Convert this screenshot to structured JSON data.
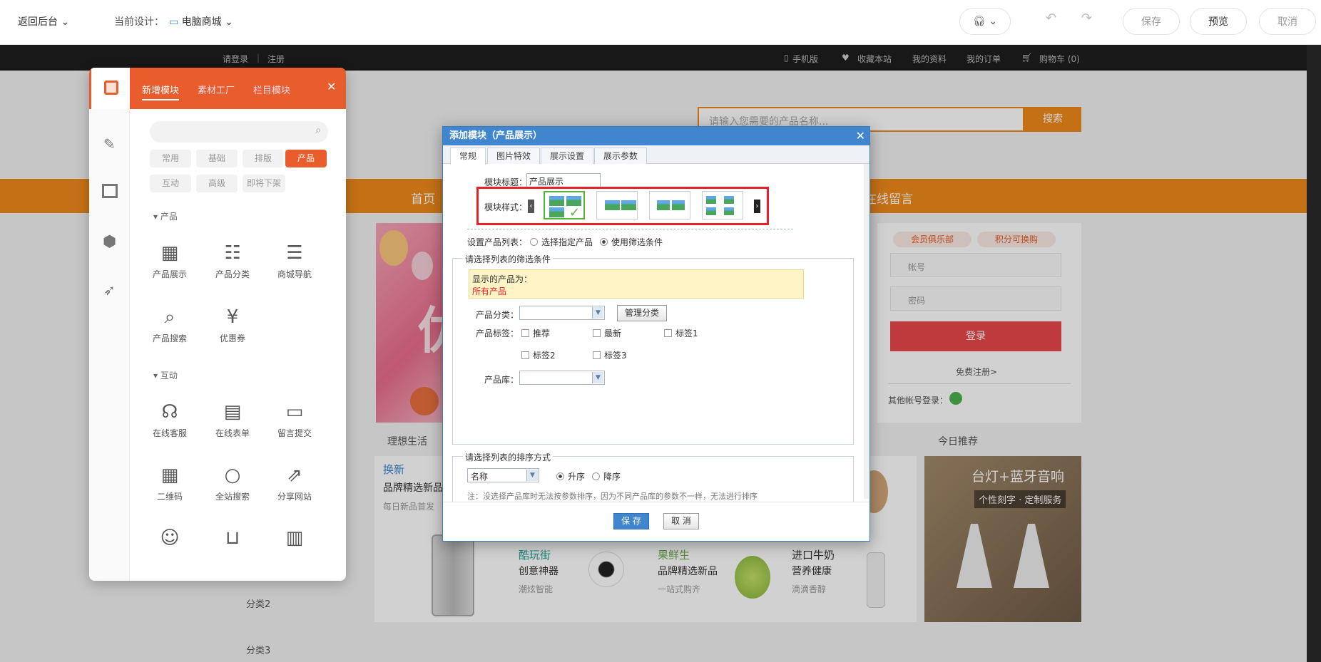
{
  "editor_bar": {
    "back": "返回后台",
    "current_label": "当前设计：",
    "design": "电脑商城",
    "save": "保存",
    "preview": "预览",
    "cancel": "取消"
  },
  "site_top": {
    "login": "请登录",
    "register": "注册",
    "mobile": "手机版",
    "favorite": "收藏本站",
    "profile": "我的资料",
    "orders": "我的订单",
    "cart": "购物车 (0)"
  },
  "search": {
    "placeholder": "请输入您需要的产品名称...",
    "button": "搜索"
  },
  "nav": {
    "home": "首页",
    "message": "在线留言"
  },
  "login_panel": {
    "club": "会员俱乐部",
    "points": "积分可换购",
    "account": "帐号",
    "password": "密码",
    "login": "登录",
    "register": "免费注册>",
    "other": "其他帐号登录："
  },
  "content": {
    "life": "理想生活",
    "today": "今日推荐",
    "swap": "换新",
    "swap_title": "品牌精选新品",
    "swap_sub": "每日新品首发",
    "cool": "酷玩街",
    "cool_title": "创意神器",
    "cool_sub": "潮炫智能",
    "fresh": "果鲜生",
    "fresh_title": "品牌精选新品",
    "fresh_sub": "一站式购齐",
    "milk": "进口牛奶",
    "milk_title": "营养健康",
    "milk_sub": "滴滴香醇",
    "promo_title": "台灯+蓝牙音响",
    "promo_sub": "个性刻字 · 定制服务",
    "cat2": "分类2",
    "cat3": "分类3",
    "banner_char": "优"
  },
  "left_panel": {
    "tabs": [
      "新增模块",
      "素材工厂",
      "栏目模块"
    ],
    "chips": [
      "常用",
      "基础",
      "排版",
      "产品",
      "互动",
      "高级",
      "即将下架"
    ],
    "section_product": "产品",
    "section_interact": "互动",
    "product_mods": [
      "产品展示",
      "产品分类",
      "商城导航",
      "产品搜索",
      "优惠券"
    ],
    "interact_mods": [
      "在线客服",
      "在线表单",
      "留言提交",
      "二维码",
      "全站搜索",
      "分享网站"
    ]
  },
  "dialog": {
    "title": "添加模块（产品展示）",
    "tabs": [
      "常规",
      "图片特效",
      "展示设置",
      "展示参数"
    ],
    "module_title_label": "模块标题：",
    "module_title_value": "产品展示",
    "style_label": "模块样式：",
    "set_list_label": "设置产品列表：",
    "opt_specified": "选择指定产品",
    "opt_filter": "使用筛选条件",
    "filter_legend": "请选择列表的筛选条件",
    "show_label": "显示的产品为：",
    "show_value": "所有产品",
    "category_label": "产品分类：",
    "manage_category": "管理分类",
    "tag_label": "产品标签：",
    "tags": [
      "推荐",
      "最新",
      "标签1",
      "标签2",
      "标签3"
    ],
    "library_label": "产品库：",
    "sort_legend": "请选择列表的排序方式",
    "sort_field": "名称",
    "asc": "升序",
    "desc": "降序",
    "note": "注：没选择产品库时无法按参数排序，因为不同产品库的参数不一样，无法进行排序",
    "save": "保 存",
    "cancel": "取 消"
  },
  "colors": {
    "orange": "#f08a1c",
    "panel_red": "#e85d2b",
    "dialog_blue": "#3f86cf",
    "highlight": "#e8202a",
    "login_red": "#e8474a"
  }
}
